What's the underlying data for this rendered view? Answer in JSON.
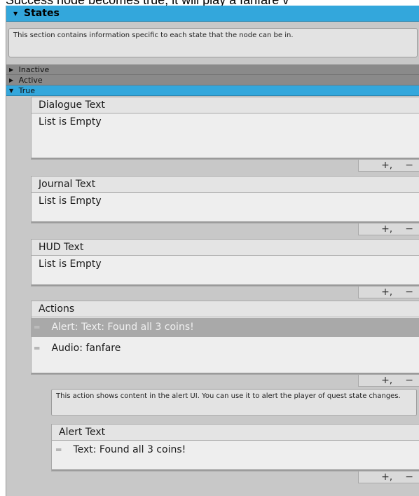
{
  "window": {
    "caption": "Success node becomes true, it will play a fanfare v"
  },
  "states": {
    "header": "States",
    "help": "This section contains information specific to each state that the node can be in.",
    "rows": [
      {
        "label": "Inactive",
        "expanded": false
      },
      {
        "label": "Active",
        "expanded": false
      },
      {
        "label": "True",
        "expanded": true
      }
    ]
  },
  "true_state": {
    "dialogue": {
      "label": "Dialogue Text",
      "empty": "List is Empty"
    },
    "journal": {
      "label": "Journal Text",
      "empty": "List is Empty"
    },
    "hud": {
      "label": "HUD Text",
      "empty": "List is Empty"
    },
    "actions": {
      "label": "Actions",
      "items": [
        {
          "text": "Alert: Text: Found all 3 coins!",
          "selected": true
        },
        {
          "text": "Audio: fanfare",
          "selected": false
        }
      ]
    },
    "action_detail": {
      "help": "This action shows content in the alert UI. You can use it to alert the player of quest state changes.",
      "alert_label": "Alert Text",
      "alert_items": [
        {
          "text": "Text: Found all 3 coins!"
        }
      ]
    }
  },
  "controls": {
    "add": "+,",
    "remove": "−"
  }
}
